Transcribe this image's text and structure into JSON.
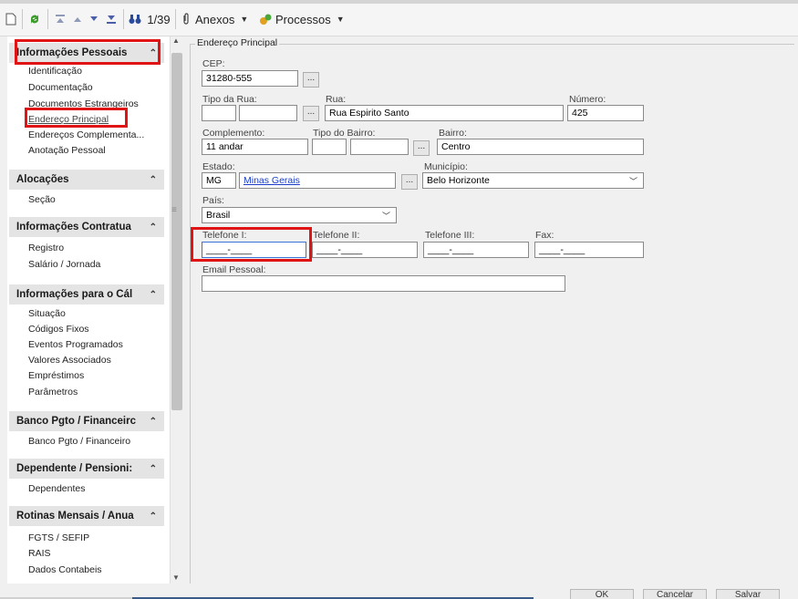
{
  "toolbar": {
    "record_counter": "1/39",
    "anexos_label": "Anexos",
    "processos_label": "Processos"
  },
  "sidebar": {
    "sections": [
      {
        "title": "Informações Pessoais",
        "items": [
          "Identificação",
          "Documentação",
          "Documentos Estrangeiros",
          "Endereço Principal",
          "Endereços Complementa...",
          "Anotação Pessoal"
        ]
      },
      {
        "title": "Alocações",
        "items": [
          "Seção"
        ]
      },
      {
        "title": "Informações Contratua",
        "items": [
          "Registro",
          "Salário / Jornada"
        ]
      },
      {
        "title": "Informações para o Cál",
        "items": [
          "Situação",
          "Códigos Fixos",
          "Eventos Programados",
          "Valores Associados",
          "Empréstimos",
          "Parâmetros"
        ]
      },
      {
        "title": "Banco Pgto / Financeirc",
        "items": [
          "Banco Pgto / Financeiro"
        ]
      },
      {
        "title": "Dependente / Pensioni:",
        "items": [
          "Dependentes"
        ]
      },
      {
        "title": "Rotinas Mensais / Anua",
        "items": [
          "FGTS / SEFIP",
          "RAIS",
          "Dados Contabeis"
        ]
      }
    ]
  },
  "form": {
    "group_title": "Endereço Principal",
    "cep_label": "CEP:",
    "cep_value": "31280-555",
    "tipo_rua_label": "Tipo da Rua:",
    "rua_label": "Rua:",
    "rua_value": "Rua Espirito Santo",
    "numero_label": "Número:",
    "numero_value": "425",
    "complemento_label": "Complemento:",
    "complemento_value": "11 andar",
    "tipo_bairro_label": "Tipo do Bairro:",
    "bairro_label": "Bairro:",
    "bairro_value": "Centro",
    "estado_label": "Estado:",
    "estado_sigla": "MG",
    "estado_nome": "Minas Gerais",
    "municipio_label": "Município:",
    "municipio_value": "Belo Horizonte",
    "pais_label": "País:",
    "pais_value": "Brasil",
    "telefone1_label": "Telefone I:",
    "telefone1_value": "____-____",
    "telefone2_label": "Telefone II:",
    "telefone2_value": "____-____",
    "telefone3_label": "Telefone III:",
    "telefone3_value": "____-____",
    "fax_label": "Fax:",
    "fax_value": "____-____",
    "email_label": "Email Pessoal:",
    "email_value": ""
  },
  "bottom_buttons": [
    "OK",
    "Cancelar",
    "Salvar"
  ],
  "colors": {
    "highlight": "#e01414",
    "link": "#1a3cc8"
  }
}
